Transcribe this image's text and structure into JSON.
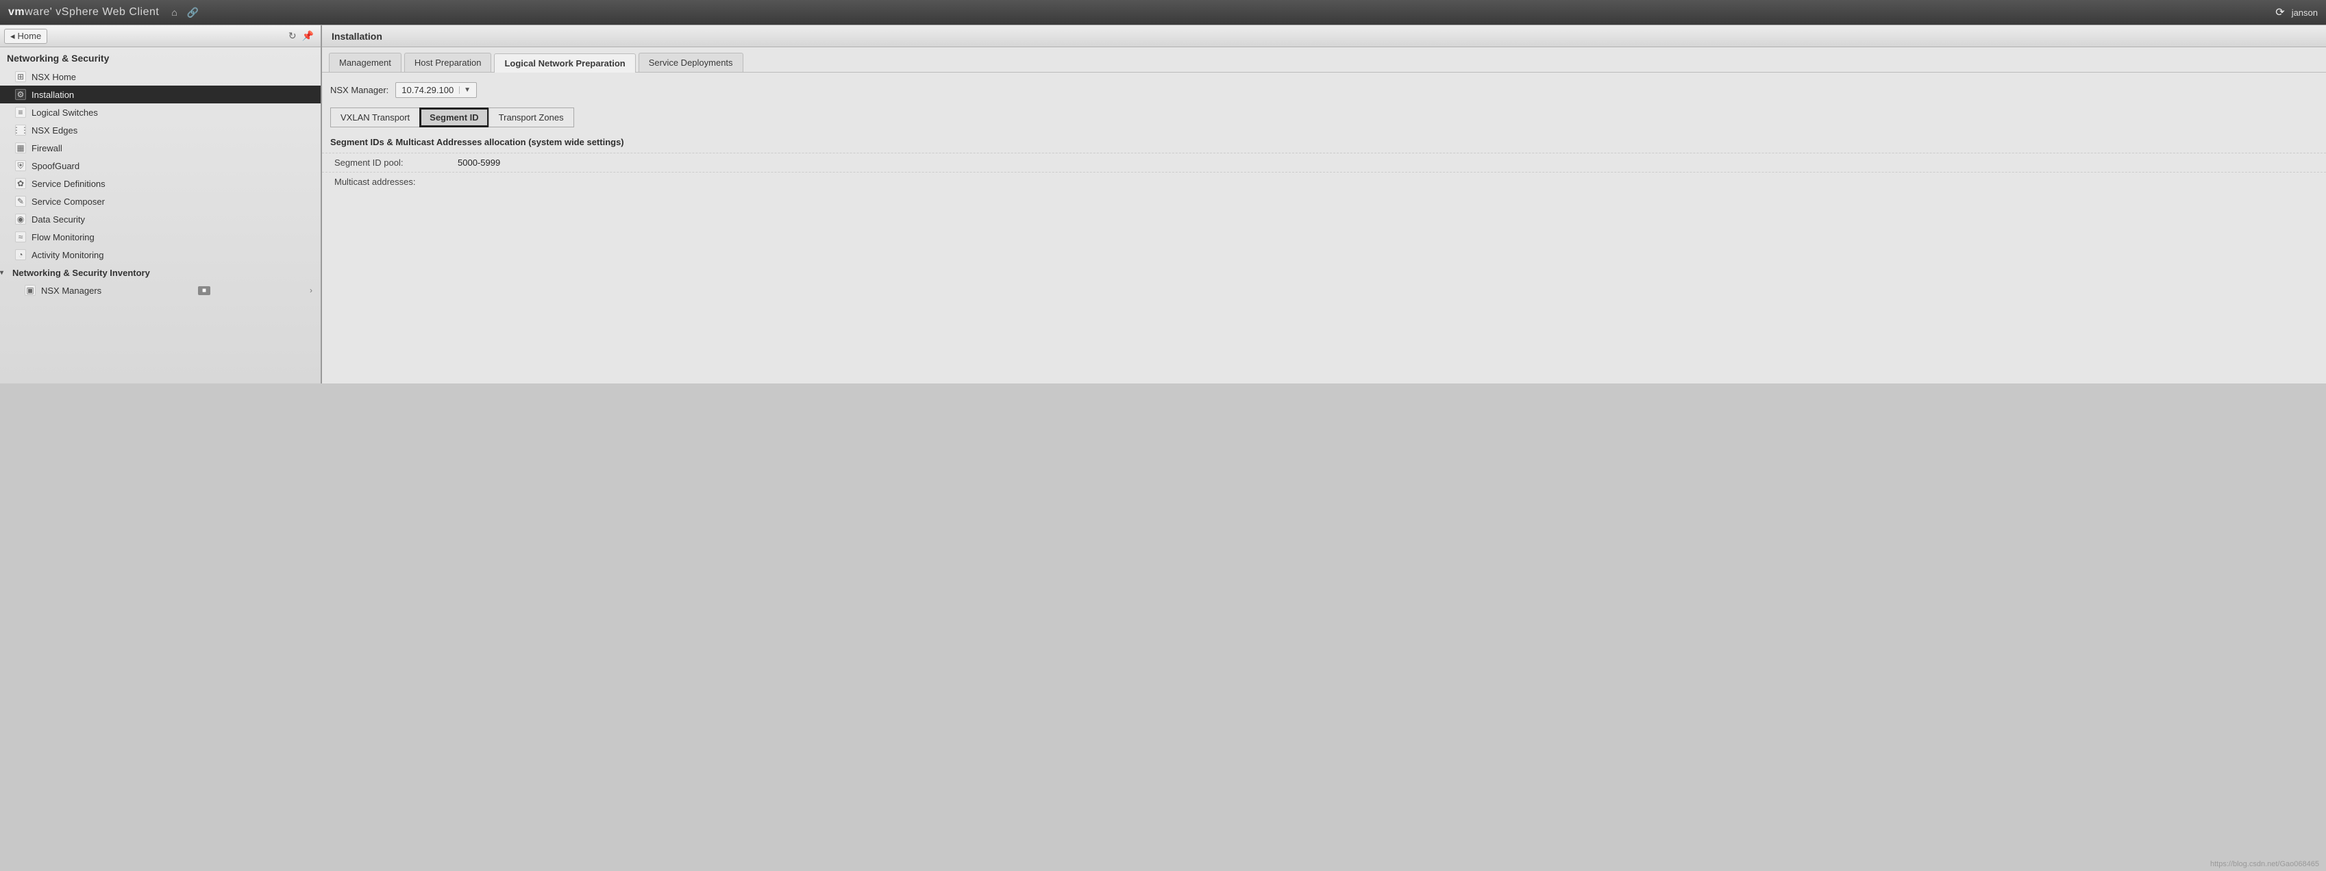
{
  "titlebar": {
    "brand_bold": "vm",
    "brand_rest": "ware' vSphere Web Client",
    "user": "janson"
  },
  "sidebar": {
    "home_label": "Home",
    "section_title": "Networking & Security",
    "items": [
      {
        "label": "NSX Home",
        "selected": false
      },
      {
        "label": "Installation",
        "selected": true
      },
      {
        "label": "Logical Switches",
        "selected": false
      },
      {
        "label": "NSX Edges",
        "selected": false
      },
      {
        "label": "Firewall",
        "selected": false
      },
      {
        "label": "SpoofGuard",
        "selected": false
      },
      {
        "label": "Service Definitions",
        "selected": false
      },
      {
        "label": "Service Composer",
        "selected": false
      },
      {
        "label": "Data Security",
        "selected": false
      },
      {
        "label": "Flow Monitoring",
        "selected": false
      },
      {
        "label": "Activity Monitoring",
        "selected": false
      }
    ],
    "inventory_label": "Networking & Security Inventory",
    "inventory_child": "NSX Managers"
  },
  "content": {
    "header": "Installation",
    "tabs": [
      {
        "label": "Management",
        "active": false
      },
      {
        "label": "Host Preparation",
        "active": false
      },
      {
        "label": "Logical Network Preparation",
        "active": true
      },
      {
        "label": "Service Deployments",
        "active": false
      }
    ],
    "nsx_manager_label": "NSX Manager:",
    "nsx_manager_value": "10.74.29.100",
    "subtabs": [
      {
        "label": "VXLAN Transport",
        "active": false
      },
      {
        "label": "Segment ID",
        "active": true
      },
      {
        "label": "Transport Zones",
        "active": false
      }
    ],
    "section_heading": "Segment IDs & Multicast Addresses allocation (system wide settings)",
    "rows": [
      {
        "k": "Segment ID pool:",
        "v": "5000-5999"
      },
      {
        "k": "Multicast addresses:",
        "v": ""
      }
    ]
  },
  "watermark": "https://blog.csdn.net/Gao068465"
}
